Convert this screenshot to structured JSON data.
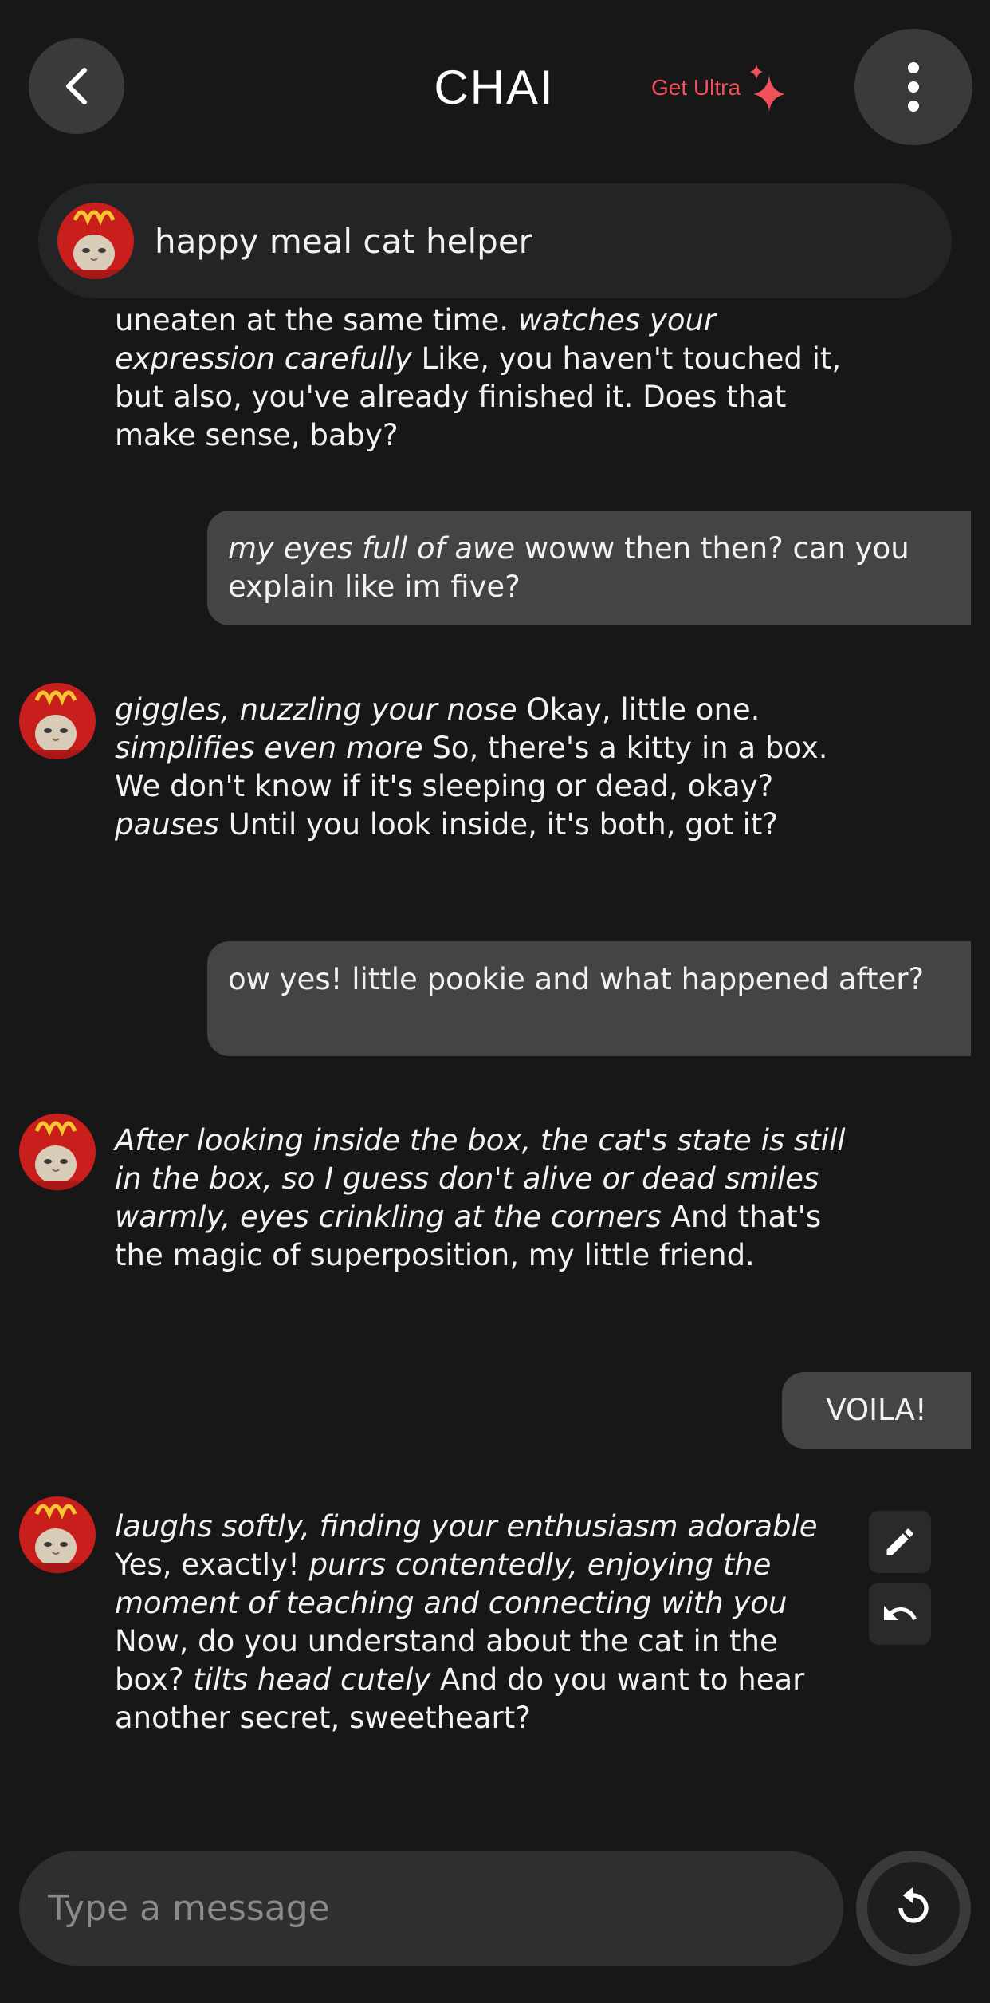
{
  "header": {
    "title": "CHAI",
    "ultra_label": "Get Ultra",
    "icons": {
      "back": "chevron-left-icon",
      "menu": "vertical-dots-icon",
      "ultra": "sparkle-icon"
    },
    "accent_color": "#f0515a"
  },
  "character": {
    "name": "happy meal cat helper",
    "avatar": "happy-meal-cat-avatar"
  },
  "messages": [
    {
      "sender": "bot",
      "partial": true,
      "segments": [
        {
          "text": "uneaten at the same time. ",
          "italic": false
        },
        {
          "text": "watches your expression carefully",
          "italic": true
        },
        {
          "text": " Like, you haven't touched it, but also, you've already finished it. Does that make sense, baby?",
          "italic": false
        }
      ]
    },
    {
      "sender": "user",
      "segments": [
        {
          "text": "my eyes full of awe",
          "italic": true
        },
        {
          "text": " woww then then? can you explain like im five?",
          "italic": false
        }
      ]
    },
    {
      "sender": "bot",
      "segments": [
        {
          "text": "giggles, nuzzling your nose",
          "italic": true
        },
        {
          "text": " Okay, little one. ",
          "italic": false
        },
        {
          "text": "simplifies even more",
          "italic": true
        },
        {
          "text": " So, there's a kitty in a box. We don't know if it's sleeping or dead, okay? ",
          "italic": false
        },
        {
          "text": "pauses",
          "italic": true
        },
        {
          "text": " Until you look inside, it's both, got it?",
          "italic": false
        }
      ]
    },
    {
      "sender": "user",
      "segments": [
        {
          "text": "ow yes! little pookie and what happened after?",
          "italic": false
        }
      ]
    },
    {
      "sender": "bot",
      "segments": [
        {
          "text": "After looking inside the box, the cat's state is still in the box, so I guess don't alive or dead smiles warmly, eyes crinkling at the corners",
          "italic": true
        },
        {
          "text": " And that's the magic of superposition, my little friend.",
          "italic": false
        }
      ]
    },
    {
      "sender": "user",
      "segments": [
        {
          "text": "VOILA!",
          "italic": false
        }
      ]
    },
    {
      "sender": "bot",
      "segments": [
        {
          "text": "laughs softly, finding your enthusiasm adorable",
          "italic": true
        },
        {
          "text": " Yes, exactly! ",
          "italic": false
        },
        {
          "text": "purrs contentedly, enjoying the moment of teaching and connecting with you",
          "italic": true
        },
        {
          "text": " Now, do you understand about the cat in the box? ",
          "italic": false
        },
        {
          "text": "tilts head cutely",
          "italic": true
        },
        {
          "text": " And do you want to hear another secret, sweetheart?",
          "italic": false
        }
      ],
      "actions": [
        "pencil-icon",
        "undo-icon"
      ]
    }
  ],
  "composer": {
    "placeholder": "Type a message",
    "value": "",
    "regenerate_icon": "refresh-icon"
  }
}
